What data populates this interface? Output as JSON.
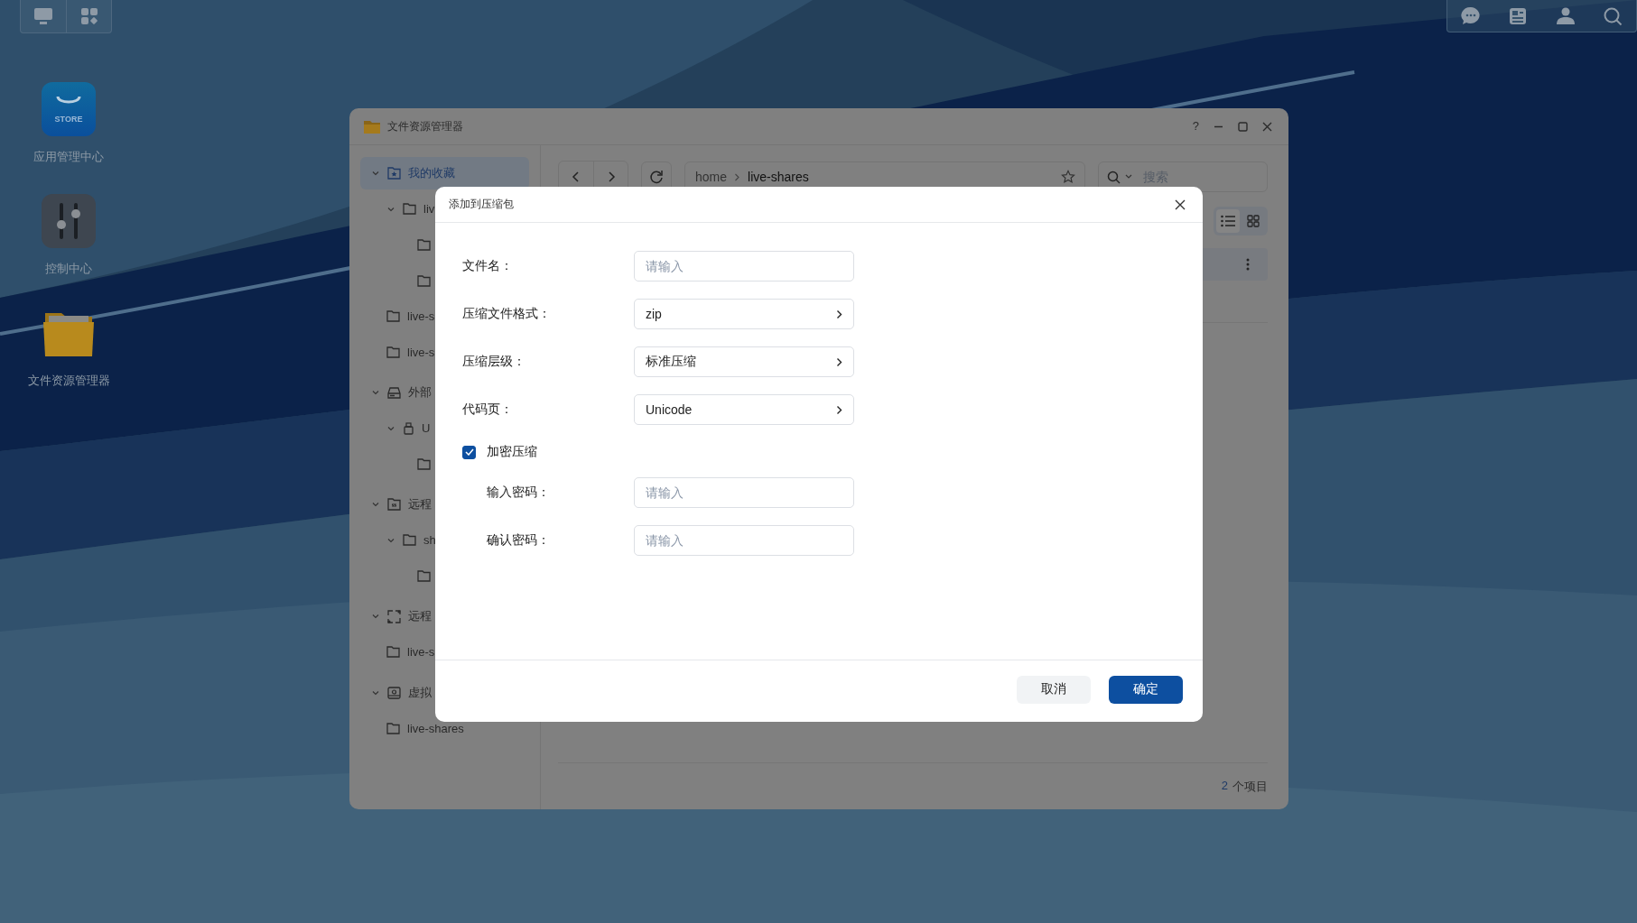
{
  "taskbar": {
    "left_buttons": [
      {
        "kind": "monitor"
      },
      {
        "kind": "widgets"
      }
    ],
    "right_buttons": [
      {
        "kind": "chat"
      },
      {
        "kind": "news"
      },
      {
        "kind": "user"
      },
      {
        "kind": "search"
      }
    ]
  },
  "desktop_icons": [
    {
      "kind": "store",
      "label": "应用管理中心",
      "badge": "STORE"
    },
    {
      "kind": "control",
      "label": "控制中心"
    },
    {
      "kind": "folder",
      "label": "文件资源管理器"
    }
  ],
  "window": {
    "title": "文件资源管理器",
    "help": "?"
  },
  "sidebar": {
    "items": [
      {
        "kind": "favorites",
        "label": "我的收藏",
        "selected": true,
        "expanded": true,
        "children": [
          {
            "kind": "folder",
            "label": "liv",
            "selected": false,
            "expanded": true,
            "children": [
              {
                "kind": "folder",
                "selected": false
              },
              {
                "kind": "folder",
                "selected": false
              }
            ]
          },
          {
            "kind": "folder",
            "label": "live-s",
            "selected": false
          },
          {
            "kind": "folder",
            "label": "live-s",
            "selected": false
          }
        ]
      },
      {
        "kind": "drive",
        "label": "外部",
        "selected": false,
        "expanded": true,
        "children": [
          {
            "kind": "usb",
            "label": "U",
            "selected": false,
            "expanded": true,
            "children": [
              {
                "kind": "folder",
                "selected": false
              }
            ]
          }
        ]
      },
      {
        "kind": "remote",
        "label": "远程",
        "selected": false,
        "expanded": true,
        "children": [
          {
            "kind": "folder",
            "label": "sh",
            "selected": false,
            "expanded": true,
            "children": [
              {
                "kind": "folder",
                "selected": false
              }
            ]
          }
        ]
      },
      {
        "kind": "link",
        "label": "远程",
        "selected": false,
        "expanded": true,
        "children": [
          {
            "kind": "folder",
            "label": "live-s",
            "selected": false
          }
        ]
      },
      {
        "kind": "virtual",
        "label": "虚拟",
        "selected": false,
        "expanded": true,
        "children": [
          {
            "kind": "folder",
            "label": "live-shares",
            "selected": false
          }
        ]
      }
    ]
  },
  "toolbar": {
    "path": [
      "home",
      "live-shares"
    ],
    "search": {
      "placeholder": "搜索"
    },
    "view_modes": [
      {
        "kind": "list",
        "selected": true
      },
      {
        "kind": "grid",
        "selected": false
      }
    ]
  },
  "footer": {
    "count": "2",
    "label": "个项目"
  },
  "dialog": {
    "title": "添加到压缩包",
    "fields": [
      {
        "kind": "text",
        "label": "文件名：",
        "placeholder": "请输入"
      },
      {
        "kind": "select",
        "label": "压缩文件格式：",
        "value": "zip"
      },
      {
        "kind": "select",
        "label": "压缩层级：",
        "value": "标准压缩"
      },
      {
        "kind": "select",
        "label": "代码页：",
        "value": "Unicode"
      }
    ],
    "encrypt": {
      "label": "加密压缩",
      "checked": true
    },
    "password_fields": [
      {
        "kind": "text",
        "label": "输入密码：",
        "placeholder": "请输入"
      },
      {
        "kind": "text",
        "label": "确认密码：",
        "placeholder": "请输入"
      }
    ],
    "buttons": [
      {
        "kind": "secondary",
        "label": "取消"
      },
      {
        "kind": "primary",
        "label": "确定"
      }
    ]
  }
}
